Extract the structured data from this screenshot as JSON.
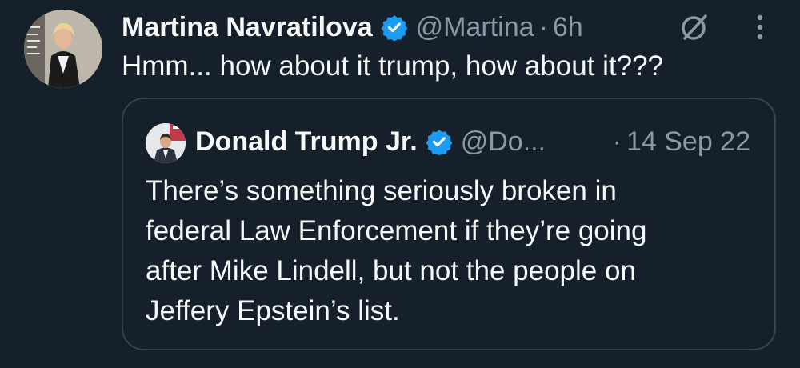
{
  "colors": {
    "background": "#15202b",
    "text_primary": "#f7f9f9",
    "text_secondary": "#8b98a5",
    "verified_badge": "#1d9bf0",
    "card_border": "#38444d"
  },
  "tweet": {
    "author_name": "Martina Navratilova",
    "handle": "@Martina",
    "separator": "·",
    "time": "6h",
    "text": "Hmm... how about it trump, how about it???",
    "icons": [
      "verified-badge-icon",
      "grok-icon",
      "more-options-icon"
    ]
  },
  "quote": {
    "author_name": "Donald Trump Jr.",
    "handle": "@Do...",
    "separator": "·",
    "date": "14 Sep 22",
    "text_lines": [
      "There’s something seriously broken in",
      "federal Law Enforcement if they’re going",
      "after Mike Lindell, but not the people on",
      "Jeffery Epstein’s list."
    ]
  }
}
